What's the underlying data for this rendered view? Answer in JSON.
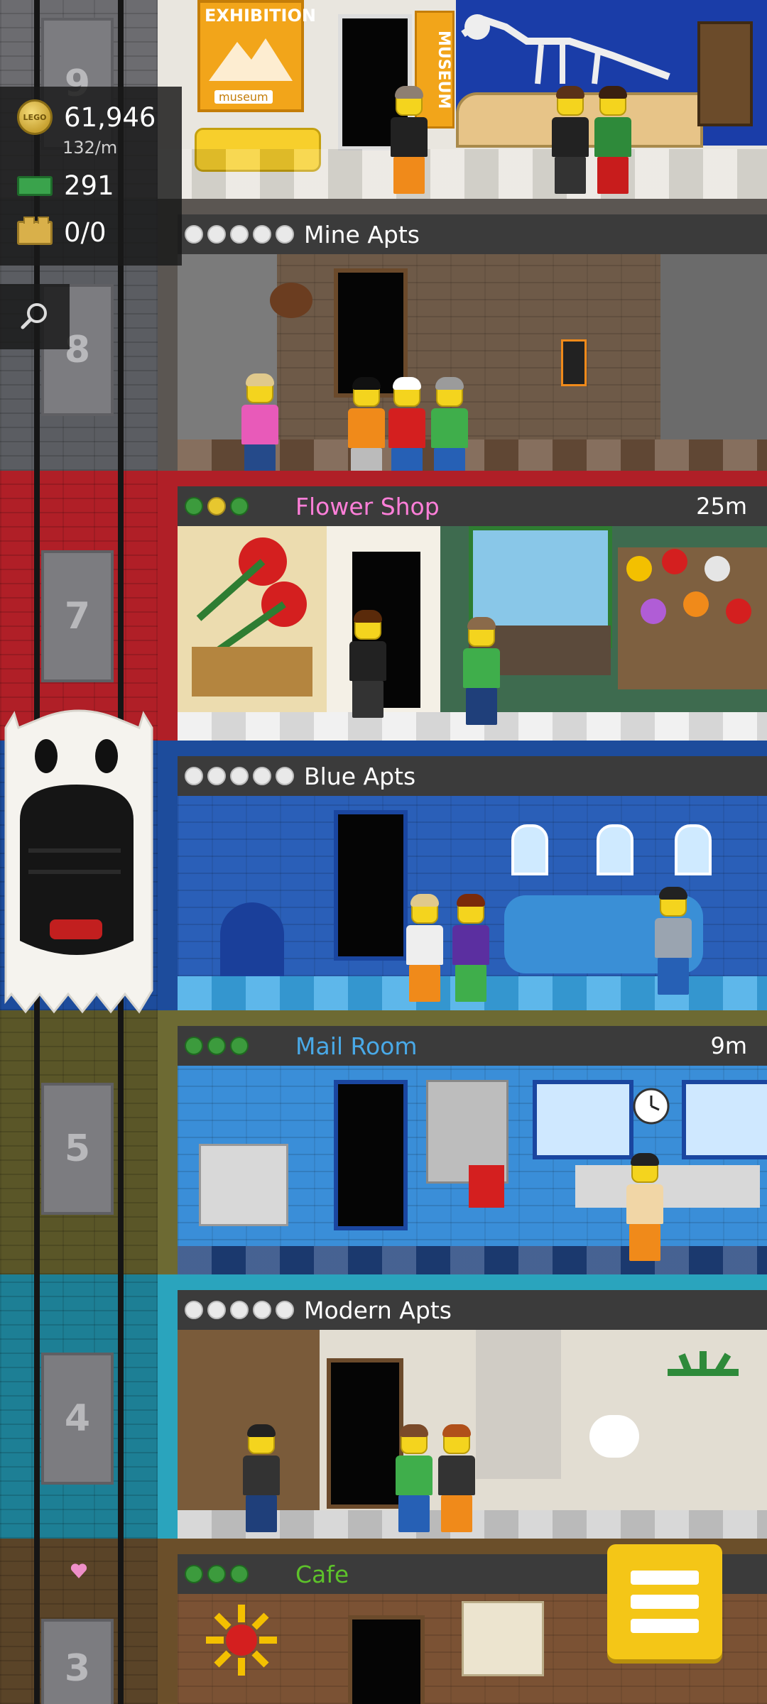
{
  "hud": {
    "coins": "61,946",
    "coins_rate": "132/m",
    "bux": "291",
    "bricks": "0/0",
    "coin_icon_text": "LEGO"
  },
  "elevator": {
    "floor_numbers": [
      "9",
      "8",
      "7",
      "5",
      "4",
      "3"
    ]
  },
  "floors": {
    "museum": {
      "sign_exhibition": "EXHIBITION",
      "sign_museum_banner": "MUSEUM",
      "sign_small": "museum"
    },
    "mine": {
      "name": "Mine Apts",
      "stars": 5
    },
    "flower": {
      "name": "Flower Shop",
      "timer": "25m",
      "name_color": "#ff7fd9"
    },
    "blue": {
      "name": "Blue Apts"
    },
    "mail": {
      "name": "Mail Room",
      "timer": "9m",
      "name_color": "#49a9e7"
    },
    "modern": {
      "name": "Modern Apts"
    },
    "cafe": {
      "name": "Cafe",
      "name_color": "#5dc22a"
    }
  },
  "colors": {
    "mine_wall": "#5b5652",
    "flower_wall": "#b01f27",
    "blue_wall": "#1d4c9c",
    "mail_wall": "#6d6a33",
    "modern_wall": "#2aa4bd",
    "cafe_wall": "#6b4f2a",
    "menu_button": "#f4c617"
  },
  "icons": [
    "coin-icon",
    "bux-icon",
    "brick-icon",
    "search-icon",
    "heart-icon",
    "ghost-icon",
    "menu-icon",
    "clock-icon"
  ]
}
